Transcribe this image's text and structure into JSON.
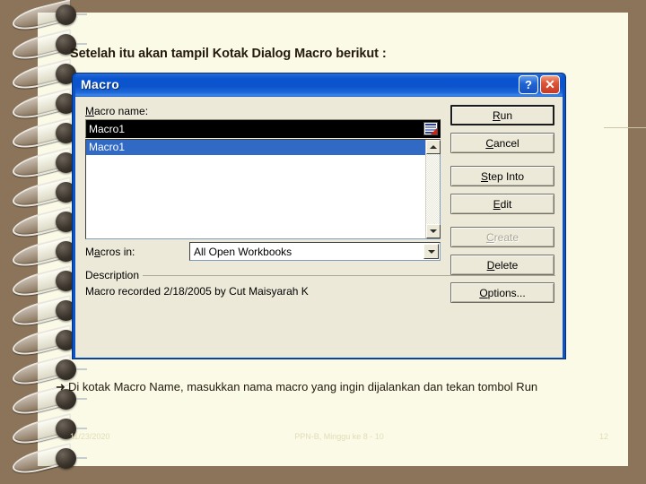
{
  "slide": {
    "heading": "Setelah itu akan tampil Kotak Dialog Macro berikut :",
    "bullet_glyph": "➜",
    "bullet_text": "Di kotak Macro Name, masukkan nama macro yang ingin dijalankan dan tekan tombol Run",
    "page_bg": "#fafae6",
    "border_bg": "#8b7459",
    "text_color": "#241a0e"
  },
  "footer": {
    "date": "11/23/2020",
    "center": "PPN-B, Minggu ke 8 - 10",
    "page_number": "12",
    "color": "#e2ddb8"
  },
  "dialog": {
    "title": "Macro",
    "titlebar_color": "#0a54cd",
    "help_button": "?",
    "close_button": "✕",
    "macro_name_label_pre": "M",
    "macro_name_label_post": "acro name:",
    "macro_name_value": "Macro1",
    "name_icon": "macro-list-icon",
    "list_items": [
      {
        "label": "Macro1",
        "selected": true
      }
    ],
    "macros_in_label_pre": "M",
    "macros_in_label_key": "a",
    "macros_in_label_post": "cros in:",
    "macros_in_value": "All Open Workbooks",
    "description_label": "Description",
    "description_text": "Macro recorded 2/18/2005 by Cut Maisyarah K",
    "buttons": [
      {
        "pre": "",
        "key": "R",
        "post": "un",
        "default": true,
        "disabled": false
      },
      {
        "pre": "",
        "key": "C",
        "post": "ancel",
        "default": false,
        "disabled": false
      },
      {
        "pre": "",
        "key": "S",
        "post": "tep Into",
        "default": false,
        "disabled": false
      },
      {
        "pre": "",
        "key": "E",
        "post": "dit",
        "default": false,
        "disabled": false
      },
      {
        "pre": "",
        "key": "C",
        "post": "reate",
        "default": false,
        "disabled": true
      },
      {
        "pre": "",
        "key": "D",
        "post": "elete",
        "default": false,
        "disabled": false
      },
      {
        "pre": "",
        "key": "O",
        "post": "ptions...",
        "default": false,
        "disabled": false
      }
    ]
  }
}
